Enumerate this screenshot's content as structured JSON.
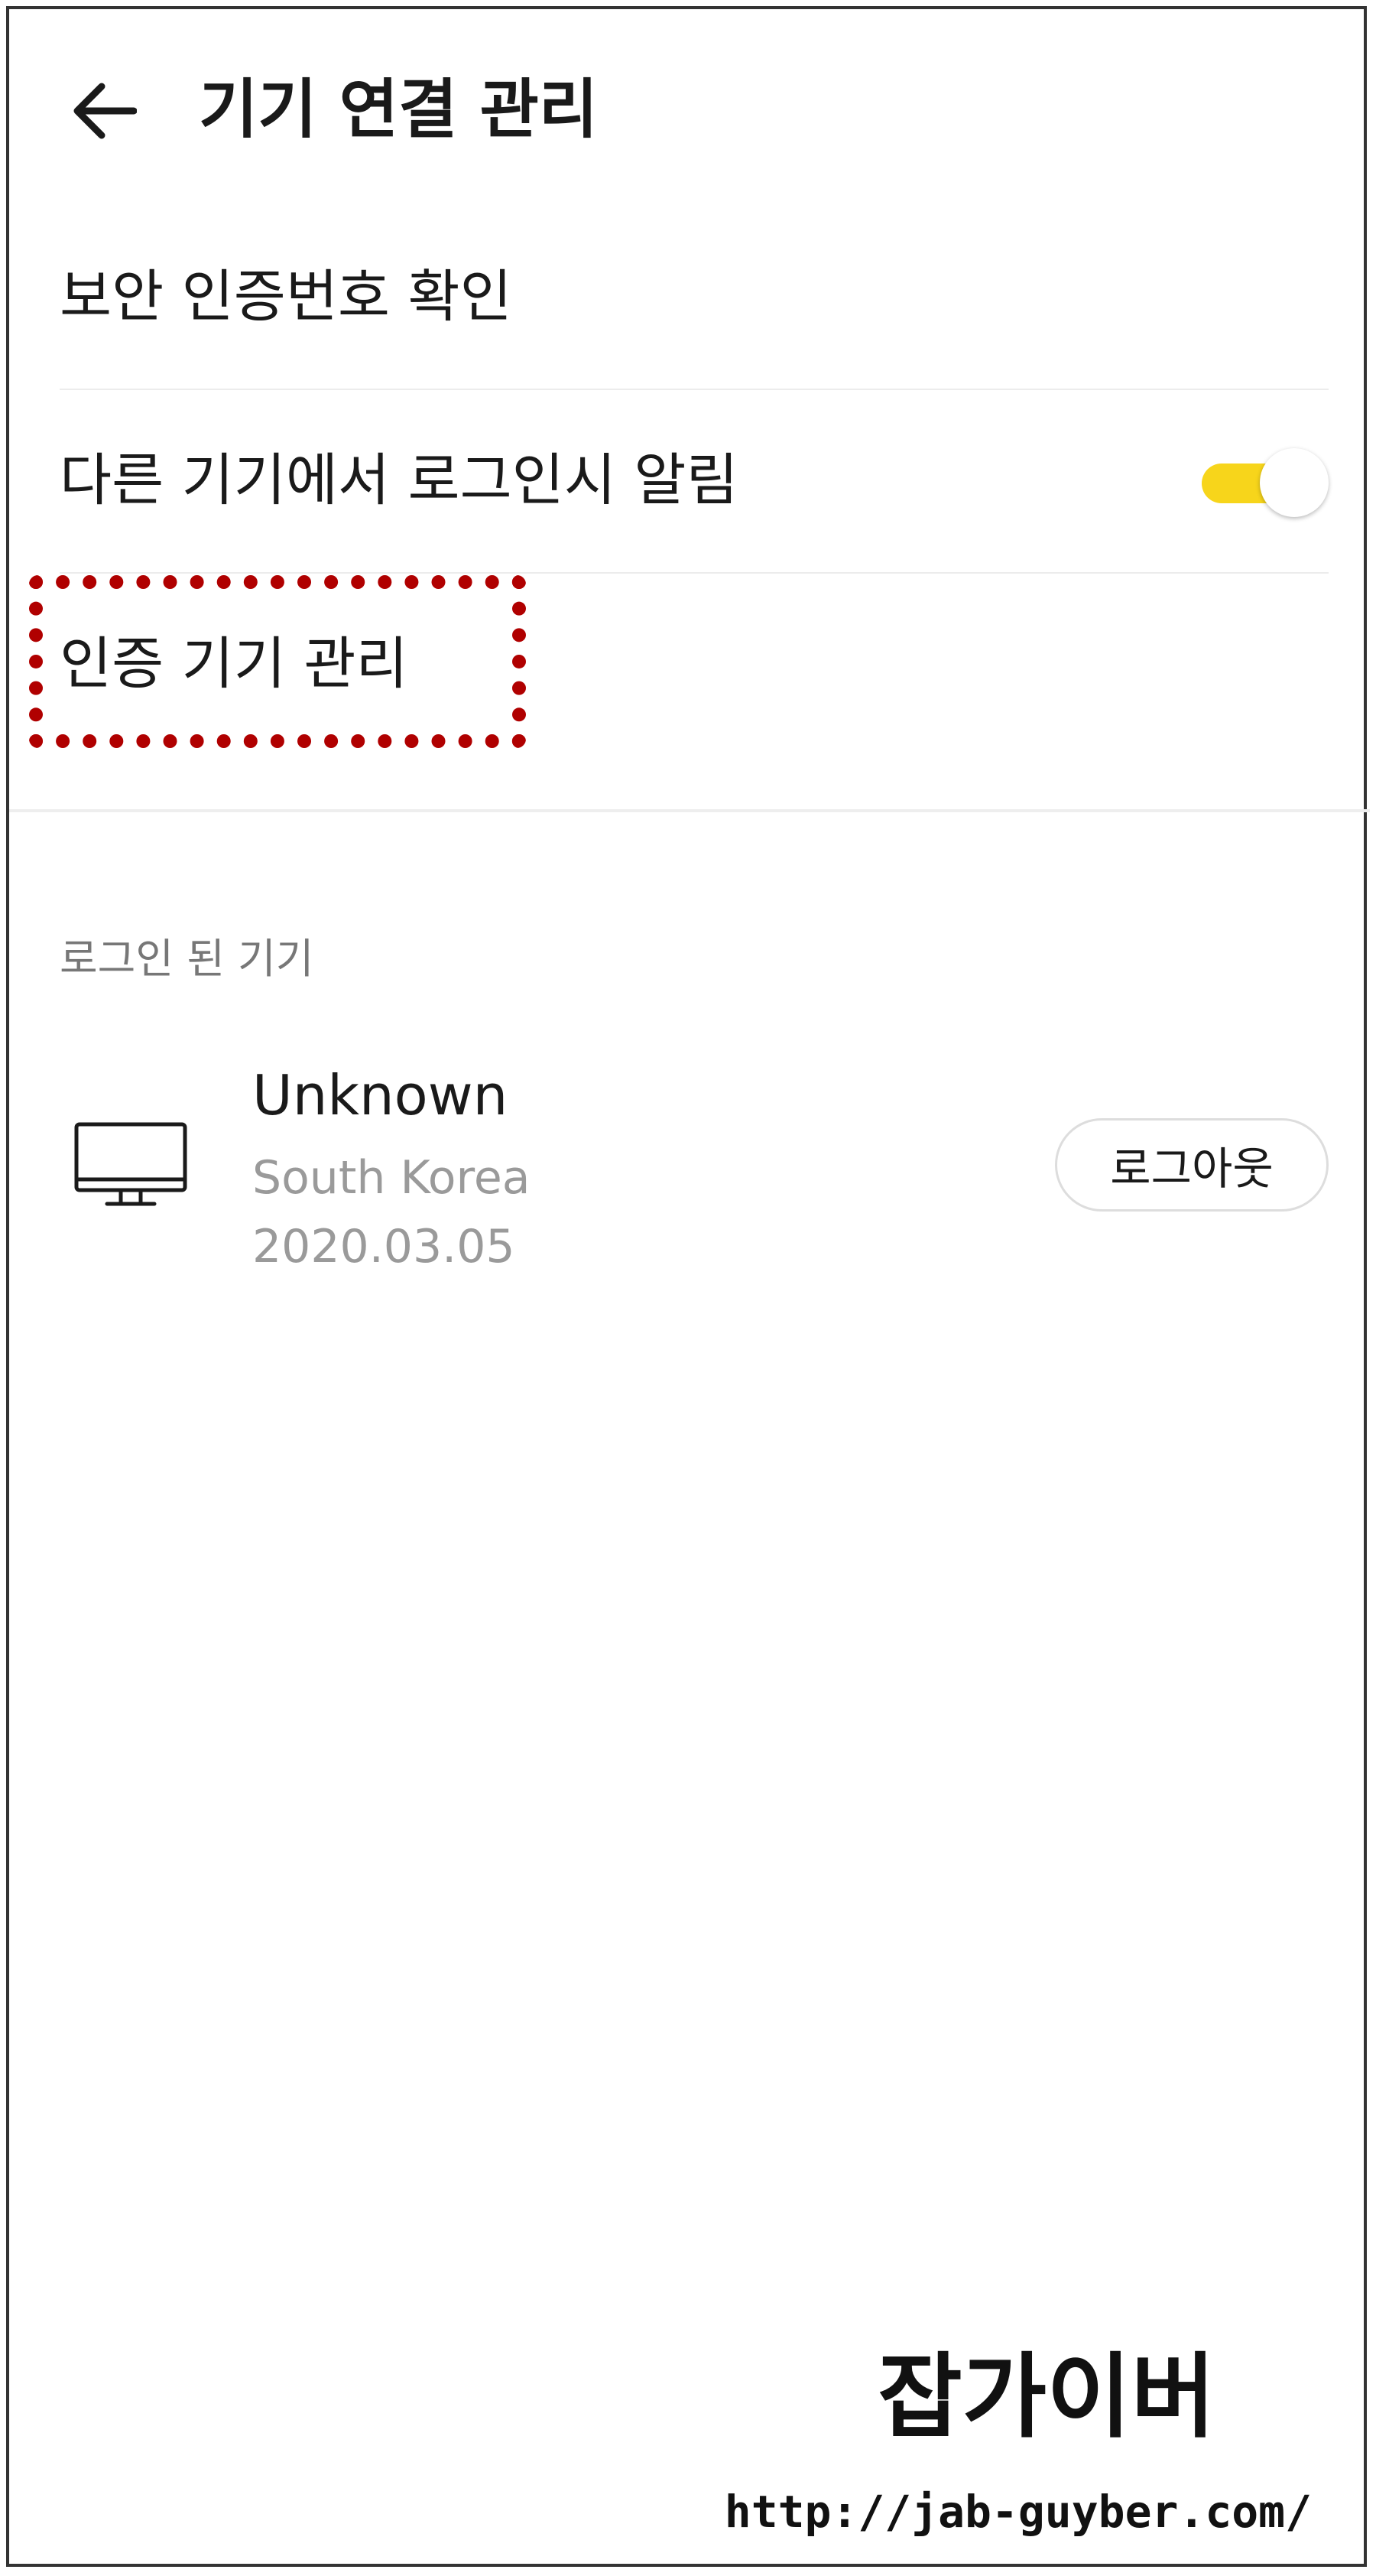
{
  "header": {
    "title": "기기 연결 관리",
    "back_icon": "arrow-left-icon"
  },
  "settings": {
    "items": [
      {
        "label": "보안 인증번호 확인"
      },
      {
        "label": "다른 기기에서 로그인시 알림",
        "toggle_on": true
      },
      {
        "label": "인증 기기 관리",
        "highlighted": true
      }
    ]
  },
  "logged_in_section": {
    "label": "로그인 된 기기",
    "devices": [
      {
        "name": "Unknown",
        "country": "South Korea",
        "date": "2020.03.05",
        "icon": "desktop-monitor-icon",
        "logout_label": "로그아웃"
      }
    ]
  },
  "watermark": {
    "title": "잡가이버",
    "url": "http://jab-guyber.com/"
  },
  "colors": {
    "toggle_accent": "#f7d51b",
    "highlight": "#b00000",
    "secondary_text": "#9a9a9a",
    "section_label": "#777777",
    "divider": "#ececec"
  }
}
